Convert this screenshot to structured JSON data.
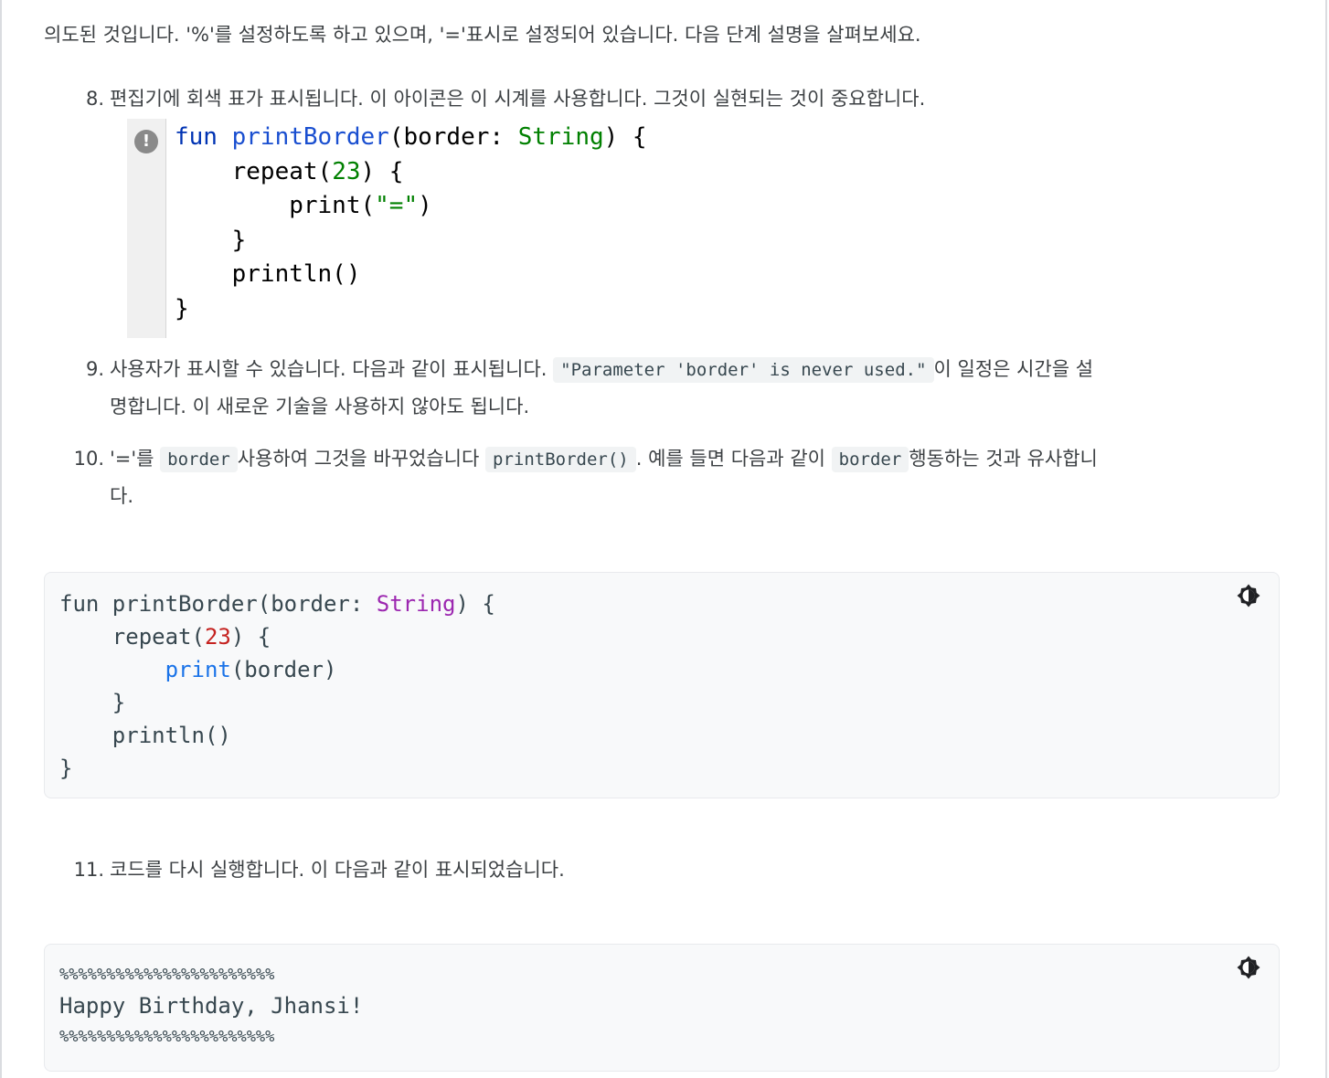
{
  "intro_text": "의도된 것입니다. '%'를 설정하도록 하고 있으며, '='표시로 설정되어 있습니다. 다음 단계 설명을 살펴보세요.",
  "steps": {
    "s8": {
      "num": "8.",
      "text": "편집기에 회색 표가 표시됩니다. 이 아이콘은 이 시계를 사용합니다. 그것이 실현되는 것이 중요합니다."
    },
    "s9": {
      "num": "9.",
      "before": "사용자가 표시할 수 있습니다. 다음과 같이 표시됩니다.",
      "code": "\"Parameter 'border' is never used.\"",
      "after_line1": "이 일정은 시간을 설",
      "line2": "명합니다. 이 새로운 기술을 사용하지 않아도 됩니다."
    },
    "s10": {
      "num": "10.",
      "p1": "'='를",
      "c1": "border",
      "p2": "사용하여 그것을 바꾸었습니다",
      "c2": "printBorder()",
      "p3": ". 예를 들면 다음과 같이",
      "c3": "border",
      "p4": "행동하는 것과 유사합니",
      "line2": "다."
    },
    "s11": {
      "num": "11.",
      "text": "코드를 다시 실행합니다. 이 다음과 같이 표시되었습니다."
    }
  },
  "ide": {
    "l1_fun": "fun",
    "l1_name": "printBorder",
    "l1_rest1": "(border: ",
    "l1_type": "String",
    "l1_rest2": ") {",
    "l2_a": "    repeat(",
    "l2_num": "23",
    "l2_b": ") {",
    "l3_a": "        print(",
    "l3_str": "\"=\"",
    "l3_b": ")",
    "l4": "    }",
    "l5": "    println()",
    "l6": "}",
    "warning_icon": "exclamation-circle-icon"
  },
  "code1": {
    "l1_a": "fun printBorder(border: ",
    "l1_type": "String",
    "l1_b": ") {",
    "l2_a": "    repeat(",
    "l2_num": "23",
    "l2_b": ") {",
    "l3_indent": "        ",
    "l3_fn": "print",
    "l3_b": "(border)",
    "l4": "    }",
    "l5": "    println()",
    "l6": "}"
  },
  "code2": {
    "l1": "%%%%%%%%%%%%%%%%%%%%%%%",
    "l2": "Happy Birthday, Jhansi!",
    "l3": "%%%%%%%%%%%%%%%%%%%%%%%"
  },
  "icons": {
    "theme_toggle": "brightness-contrast-icon"
  }
}
